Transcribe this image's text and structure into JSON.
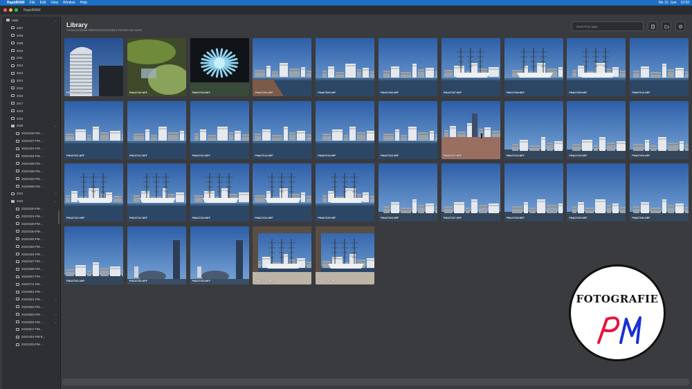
{
  "menubar": {
    "app": "RapidRAW",
    "items": [
      "File",
      "Edit",
      "View",
      "Window",
      "Help"
    ],
    "status": [
      "Mo 10. Juni",
      "10:58"
    ]
  },
  "window": {
    "title": "RapidRAW"
  },
  "sidebar": {
    "items": [
      {
        "label": "HMD",
        "level": 0,
        "open": true,
        "chev": "⌄"
      },
      {
        "label": "2007",
        "level": 1,
        "chev": ""
      },
      {
        "label": "2008",
        "level": 1,
        "chev": ""
      },
      {
        "label": "2009",
        "level": 1,
        "chev": ""
      },
      {
        "label": "2010",
        "level": 1,
        "chev": ""
      },
      {
        "label": "2011",
        "level": 1,
        "chev": ""
      },
      {
        "label": "2012",
        "level": 1,
        "chev": ""
      },
      {
        "label": "2013",
        "level": 1,
        "chev": ""
      },
      {
        "label": "2014",
        "level": 1,
        "chev": ""
      },
      {
        "label": "2015",
        "level": 1,
        "chev": ""
      },
      {
        "label": "2016",
        "level": 1,
        "chev": ""
      },
      {
        "label": "2017",
        "level": 1,
        "chev": ""
      },
      {
        "label": "2018",
        "level": 1,
        "chev": ""
      },
      {
        "label": "2019",
        "level": 1,
        "chev": ""
      },
      {
        "label": "2020",
        "level": 1,
        "open": true,
        "chev": "⌄"
      },
      {
        "label": "20220326-PM-...",
        "level": 2,
        "chev": ""
      },
      {
        "label": "20220327-PM-...",
        "level": 2,
        "chev": ""
      },
      {
        "label": "20220401-PM-...",
        "level": 2,
        "chev": ""
      },
      {
        "label": "20220404-PM-...",
        "level": 2,
        "chev": ""
      },
      {
        "label": "20220406-PM-...",
        "level": 2,
        "chev": ""
      },
      {
        "label": "20220408-PM-...",
        "level": 2,
        "chev": ""
      },
      {
        "label": "20220422-PM-...",
        "level": 2,
        "chev": ""
      },
      {
        "label": "20220508-PM-...",
        "level": 2,
        "chev": ""
      },
      {
        "label": "2021",
        "level": 1,
        "chev": ">"
      },
      {
        "label": "2022",
        "level": 1,
        "open": true,
        "chev": "⌄"
      },
      {
        "label": "20220320-PM-...",
        "level": 2,
        "chev": ""
      },
      {
        "label": "20220321-PM-...",
        "level": 2,
        "chev": ""
      },
      {
        "label": "20220329-PM-...",
        "level": 2,
        "chev": ""
      },
      {
        "label": "20220330-PM-...",
        "level": 2,
        "chev": ""
      },
      {
        "label": "20220402-PM-...",
        "level": 2,
        "chev": ""
      },
      {
        "label": "20220403-PM-...",
        "level": 2,
        "chev": ""
      },
      {
        "label": "20220404-PM-...",
        "level": 2,
        "chev": ""
      },
      {
        "label": "20220407-PM-...",
        "level": 2,
        "chev": ""
      },
      {
        "label": "20220505-PM-...",
        "level": 2,
        "chev": ""
      },
      {
        "label": "20220507-PM-...",
        "level": 2,
        "chev": ""
      },
      {
        "label": "20220711-PM-...",
        "level": 2,
        "chev": ""
      },
      {
        "label": "20220801-PM-...",
        "level": 2,
        "chev": ""
      },
      {
        "label": "20220821-PM-...",
        "level": 2,
        "chev": ">"
      },
      {
        "label": "20220822-PM-...",
        "level": 2,
        "chev": ""
      },
      {
        "label": "20220823-PM-...",
        "level": 2,
        "chev": ">"
      },
      {
        "label": "20220824-PM-...",
        "level": 2,
        "chev": "⌄"
      },
      {
        "label": "20220917-PM-...",
        "level": 2,
        "chev": ""
      },
      {
        "label": "20221001-PM-B...",
        "level": 2,
        "chev": ""
      },
      {
        "label": "20221003-PM-...",
        "level": 2,
        "chev": ""
      }
    ]
  },
  "main": {
    "title": "Library",
    "path": "/Volumes/Data/HMD/2022/20220824-PM-Bre-am-Meer",
    "search_placeholder": "Search by tags...",
    "toolbar_icons": [
      "list-icon",
      "folder-icon",
      "settings-icon"
    ]
  },
  "photos": [
    {
      "file": "PMA07001.NEF",
      "kind": "building"
    },
    {
      "file": "PMA07002.NEF",
      "kind": "green"
    },
    {
      "file": "PMA07003.NEF",
      "kind": "anemone"
    },
    {
      "file": "PMA07004.NEF",
      "kind": "harbor-pier"
    },
    {
      "file": "PMA07005.NEF",
      "kind": "harbor"
    },
    {
      "file": "PMA07006.NEF",
      "kind": "harbor"
    },
    {
      "file": "PMA07007.NEF",
      "kind": "ship"
    },
    {
      "file": "PMA07008.NEF",
      "kind": "ship"
    },
    {
      "file": "PMA07009.NEF",
      "kind": "ship"
    },
    {
      "file": "PMA07010.NEF",
      "kind": "harbor"
    },
    {
      "file": "PMA07011.NEF",
      "kind": "harbor"
    },
    {
      "file": "PMA07012.NEF",
      "kind": "harbor"
    },
    {
      "file": "PMA07013.NEF",
      "kind": "harbor"
    },
    {
      "file": "PMA07014.NEF",
      "kind": "harbor"
    },
    {
      "file": "PMA07015.NEF",
      "kind": "harbor"
    },
    {
      "file": "PMA07016.NEF",
      "kind": "harbor"
    },
    {
      "file": "PMA07017.NEF",
      "kind": "promenade"
    },
    {
      "file": "PMA07018.NEF",
      "kind": "sky"
    },
    {
      "file": "PMA07019.NEF",
      "kind": "sky"
    },
    {
      "file": "PMA07020.NEF",
      "kind": "sky"
    },
    {
      "file": "PMA07021.NEF",
      "kind": "ship"
    },
    {
      "file": "PMA07022.NEF",
      "kind": "ship"
    },
    {
      "file": "PMA07023.NEF",
      "kind": "ship"
    },
    {
      "file": "PMA07024.NEF",
      "kind": "ship"
    },
    {
      "file": "PMA07025.NEF",
      "kind": "ship"
    },
    {
      "file": "PMA07026.NEF",
      "kind": "sky"
    },
    {
      "file": "PMA07027.NEF",
      "kind": "sky"
    },
    {
      "file": "PMA07028.NEF",
      "kind": "sky"
    },
    {
      "file": "PMA07029.NEF",
      "kind": "sky"
    },
    {
      "file": "PMA07030.NEF",
      "kind": "sky"
    },
    {
      "file": "PMA07031.NEF",
      "kind": "sky"
    },
    {
      "file": "PMA07032.NEF",
      "kind": "tower"
    },
    {
      "file": "PMA07033.NEF",
      "kind": "tower"
    },
    {
      "file": "PMA07034.NEF",
      "kind": "frame"
    },
    {
      "file": "PMA07035.NEF",
      "kind": "frame"
    }
  ],
  "logo": {
    "text": "FOTOGRAFIE",
    "initials": "PM"
  }
}
